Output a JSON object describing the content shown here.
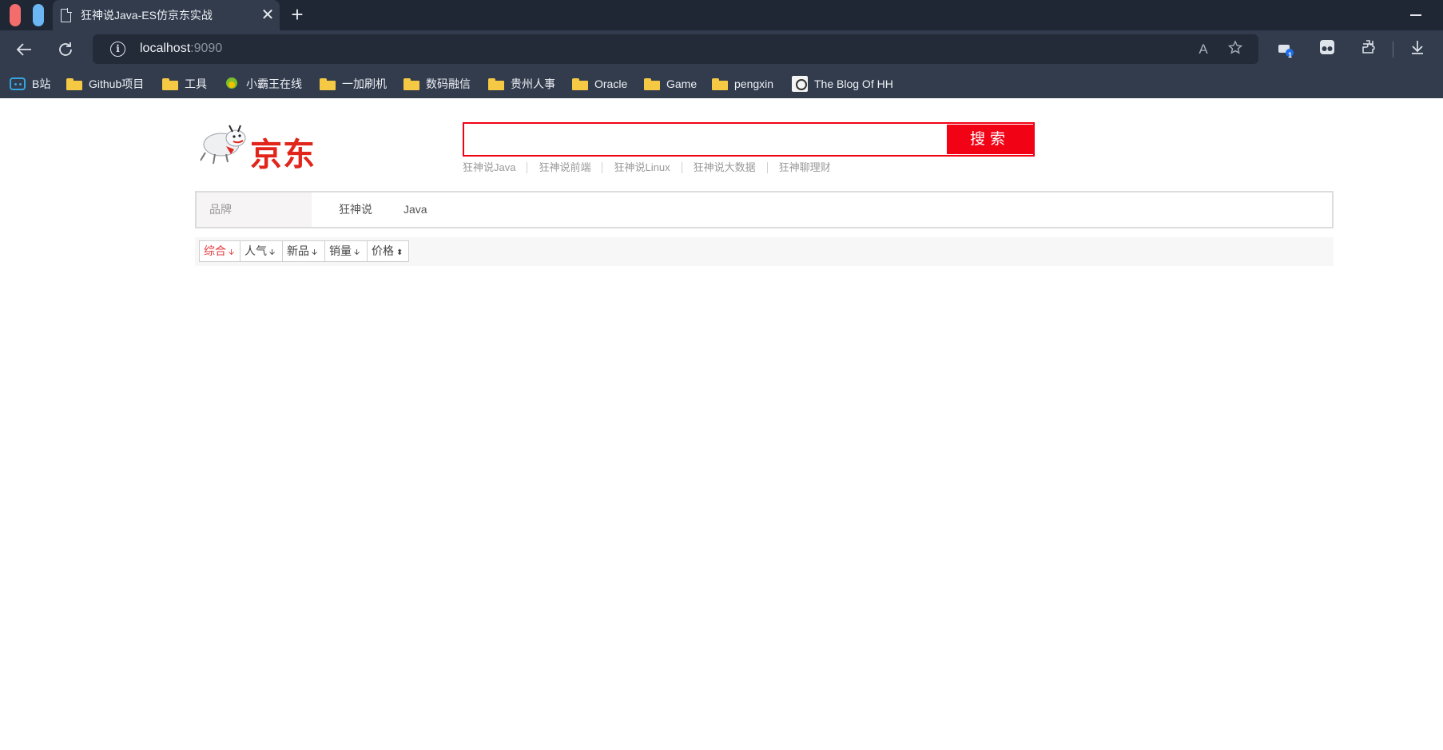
{
  "browser": {
    "tab_title": "狂神说Java-ES仿京东实战",
    "tab_close": "✕",
    "new_tab": "+",
    "url_host": "localhost",
    "url_port": ":9090",
    "read_aloud": "A",
    "extension_badge": "1"
  },
  "bookmarks": [
    {
      "label": "B站",
      "icon": "bilibili-icon"
    },
    {
      "label": "Github项目",
      "icon": "folder-icon"
    },
    {
      "label": "工具",
      "icon": "folder-icon"
    },
    {
      "label": "小霸王在线",
      "icon": "game-site-icon"
    },
    {
      "label": "一加刷机",
      "icon": "folder-icon"
    },
    {
      "label": "数码融信",
      "icon": "folder-icon"
    },
    {
      "label": "贵州人事",
      "icon": "folder-icon"
    },
    {
      "label": "Oracle",
      "icon": "folder-icon"
    },
    {
      "label": "Game",
      "icon": "folder-icon"
    },
    {
      "label": "pengxin",
      "icon": "folder-icon"
    },
    {
      "label": "The Blog Of HH",
      "icon": "blog-avatar-icon"
    }
  ],
  "page": {
    "logo_text": "京东",
    "search": {
      "value": "",
      "placeholder": "",
      "button_label": "搜索"
    },
    "hotwords": [
      "狂神说Java",
      "狂神说前端",
      "狂神说Linux",
      "狂神说大数据",
      "狂神聊理财"
    ],
    "brand_filter": {
      "label": "品牌",
      "items": [
        "狂神说",
        "Java"
      ]
    },
    "sort_options": [
      {
        "label": "综合",
        "arrow": "🡫"
      },
      {
        "label": "人气",
        "arrow": "🡫"
      },
      {
        "label": "新品",
        "arrow": "🡫"
      },
      {
        "label": "销量",
        "arrow": "🡫"
      },
      {
        "label": "价格",
        "arrow": "⬍"
      }
    ]
  },
  "colors": {
    "accent_red": "#f10215",
    "brand_red": "#e1251b",
    "chrome_dark": "#202734",
    "chrome_toolbar": "#323c4d"
  }
}
